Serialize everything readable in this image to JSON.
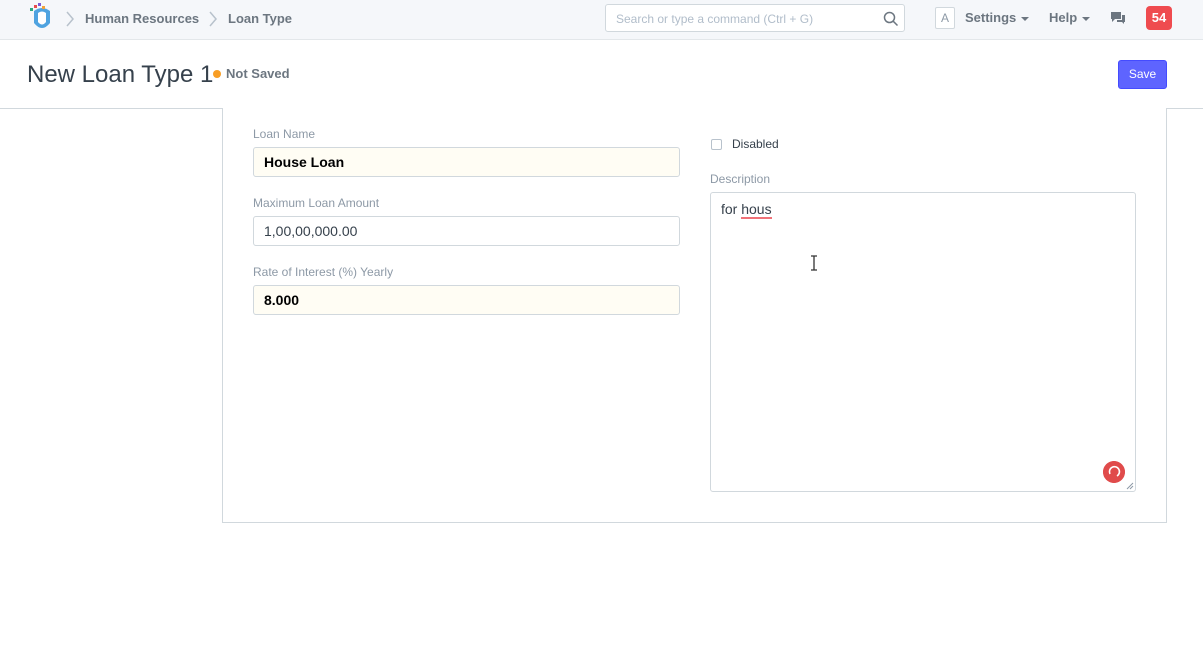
{
  "navbar": {
    "breadcrumbs": [
      "Human Resources",
      "Loan Type"
    ],
    "search_placeholder": "Search or type a command (Ctrl + G)",
    "avatar_letter": "A",
    "settings_label": "Settings",
    "help_label": "Help",
    "notification_count": "54"
  },
  "page": {
    "title": "New Loan Type 1",
    "status": "Not Saved",
    "save_label": "Save"
  },
  "form": {
    "loan_name": {
      "label": "Loan Name",
      "value": "House Loan"
    },
    "max_amount": {
      "label": "Maximum Loan Amount",
      "value": "1,00,00,000.00"
    },
    "rate": {
      "label": "Rate of Interest (%) Yearly",
      "value": "8.000"
    },
    "disabled": {
      "label": "Disabled",
      "checked": false
    },
    "description": {
      "label": "Description",
      "value_prefix": "for ",
      "value_misspelled": "hous"
    }
  },
  "colors": {
    "primary": "#5e64ff",
    "notification": "#ef4b4f",
    "status_dot": "#f89e25",
    "spellcheck": "#f07178"
  },
  "icons": [
    "app-logo-icon",
    "chevron-right-icon",
    "search-icon",
    "chat-icon",
    "caret-down-icon",
    "grammar-check-icon",
    "resize-handle-icon",
    "text-cursor-icon"
  ]
}
